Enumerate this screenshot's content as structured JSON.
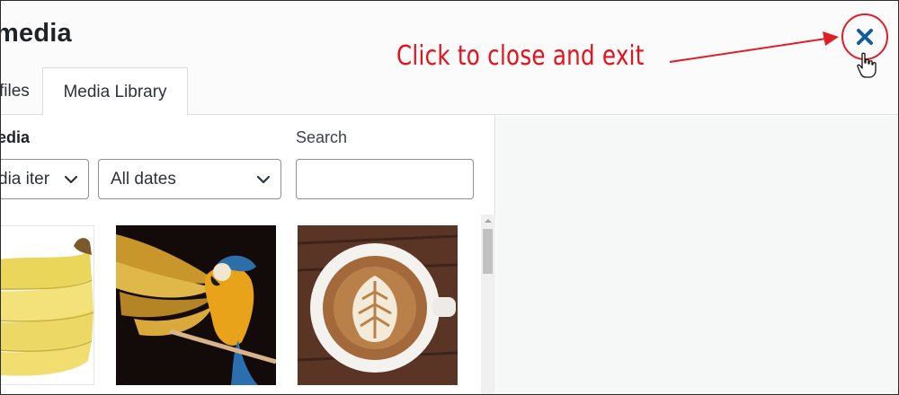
{
  "modal": {
    "title": "media",
    "tabs": [
      {
        "label": "files"
      },
      {
        "label": "Media Library"
      }
    ],
    "close_icon": "close-x-icon"
  },
  "annotation": {
    "text": "Click to close and exit",
    "color": "#e8101a"
  },
  "filters": {
    "type_label": "edia",
    "type_value": "dia iter",
    "dates_value": "All dates",
    "search_label": "Search",
    "search_value": ""
  },
  "thumbnails": [
    {
      "name": "banana"
    },
    {
      "name": "parrot"
    },
    {
      "name": "coffee"
    }
  ],
  "colors": {
    "accent": "#135e96",
    "annotation_red": "#e21d24",
    "border": "#dcdcde"
  }
}
